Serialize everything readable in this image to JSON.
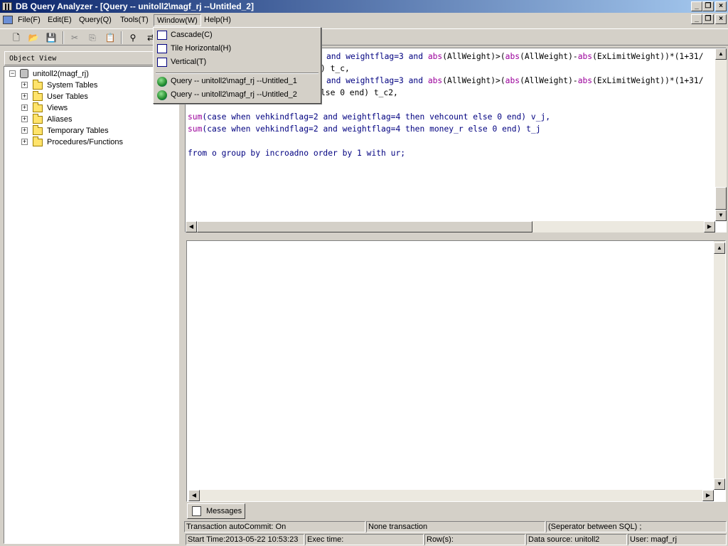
{
  "window": {
    "title": "DB Query Analyzer - [Query -- unitoll2\\magf_rj  --Untitled_2]"
  },
  "menubar": {
    "items": [
      {
        "label": "File(F)"
      },
      {
        "label": "Edit(E)"
      },
      {
        "label": "Query(Q)"
      },
      {
        "label": "Tools(T)"
      },
      {
        "label": "Window(W)"
      },
      {
        "label": "Help(H)"
      }
    ]
  },
  "window_menu": {
    "cascade": "Cascade(C)",
    "tile_horizontal": "Tile Horizontal(H)",
    "vertical": "Vertical(T)",
    "windows": [
      "Query -- unitoll2\\magf_rj  --Untitled_1",
      "Query -- unitoll2\\magf_rj  --Untitled_2"
    ]
  },
  "object_view": {
    "title": "Object View",
    "root": "unitoll2(magf_rj)",
    "children": [
      "System Tables",
      "User Tables",
      "Views",
      "Aliases",
      "Temporary Tables",
      "Procedures/Functions"
    ]
  },
  "editor": {
    "l1a": "and weightflag=3 and ",
    "l1b": "abs",
    "l1c": "(AllWeight)>(",
    "l1d": "abs",
    "l1e": "(AllWeight)-",
    "l1f": "abs",
    "l1g": "(ExLimitWeight))*(1+31/",
    "l2": ") t_c,",
    "l3a": "and weightflag=3 and ",
    "l3b": "abs",
    "l3c": "(AllWeight)>(",
    "l3d": "abs",
    "l3e": "(AllWeight)-",
    "l3f": "abs",
    "l3g": "(ExLimitWeight))*(1+31/",
    "l4": "lse 0 end) t_c2,",
    "l5a": "sum",
    "l5b": "(case when vehkindflag=2 and weightflag=4 then vehcount else 0 end) v_j,",
    "l6a": "sum",
    "l6b": "(case when vehkindflag=2 and weightflag=4 then money_r else 0 end) t_j",
    "l7": "from o group by incroadno order by 1 with ur;"
  },
  "results_tab": "Messages",
  "status": {
    "autocommit": "Transaction autoCommit: On",
    "transaction": "None transaction",
    "separator": "(Seperator between SQL)  ;",
    "start_time": "Start Time:2013-05-22 10:53:23",
    "exec_time": "Exec time:",
    "rows": "Row(s):",
    "datasource": "Data source: unitoll2",
    "user": "User: magf_rj"
  }
}
